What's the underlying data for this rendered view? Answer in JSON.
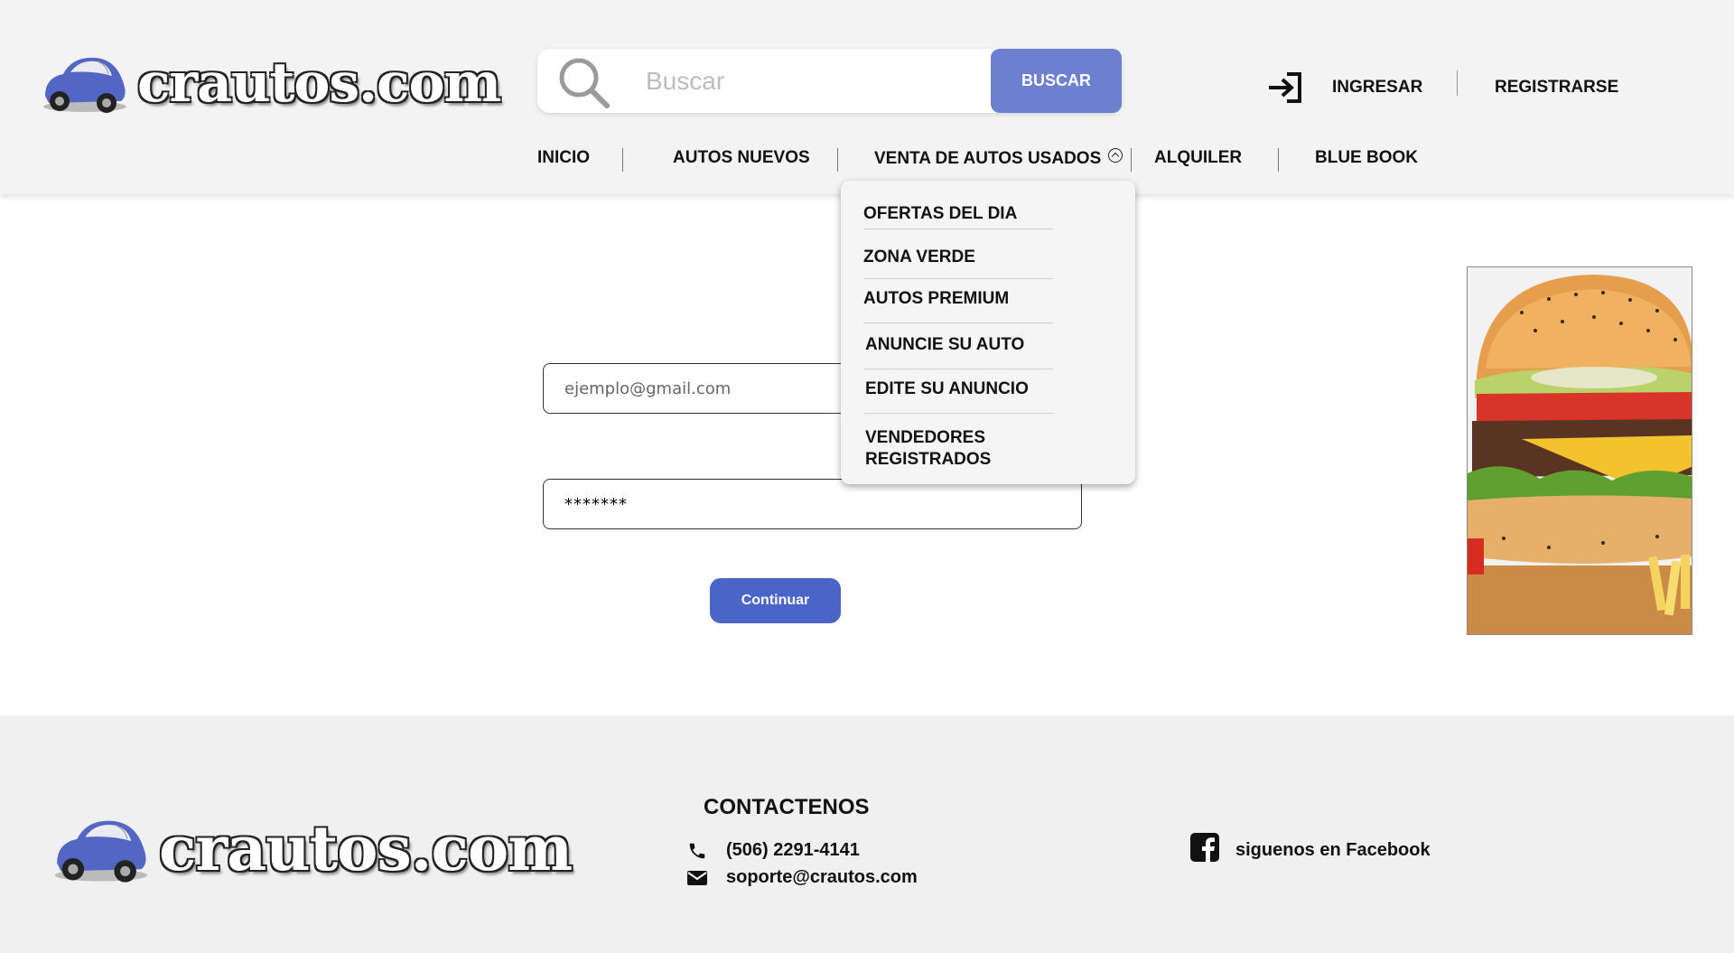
{
  "header": {
    "logo_text": "crautos.com",
    "search": {
      "placeholder": "Buscar",
      "button_label": "BUSCAR"
    },
    "login_label": "INGRESAR",
    "register_label": "REGISTRARSE"
  },
  "nav": {
    "items": [
      {
        "label": "INICIO"
      },
      {
        "label": "AUTOS NUEVOS"
      },
      {
        "label": "VENTA DE AUTOS USADOS"
      },
      {
        "label": "ALQUILER"
      },
      {
        "label": "BLUE BOOK"
      }
    ]
  },
  "dropdown": {
    "items": [
      {
        "label": "OFERTAS DEL DIA"
      },
      {
        "label": "ZONA VERDE"
      },
      {
        "label": "AUTOS PREMIUM"
      },
      {
        "label": "ANUNCIE SU AUTO"
      },
      {
        "label": "EDITE SU ANUNCIO"
      },
      {
        "label": "VENDEDORES REGISTRADOS"
      }
    ]
  },
  "form": {
    "email_placeholder": "ejemplo@gmail.com",
    "password_value": "*******",
    "continue_label": "Continuar"
  },
  "footer": {
    "logo_text": "crautos.com",
    "contact_title": "CONTACTENOS",
    "phone": "(506) 2291-4141",
    "email": "soporte@crautos.com",
    "facebook_label": "siguenos en Facebook"
  },
  "colors": {
    "accent": "#6c80cf",
    "continue_button": "#4a64c8",
    "header_bg": "#f3f3f3",
    "footer_bg": "#f0f0f0"
  }
}
